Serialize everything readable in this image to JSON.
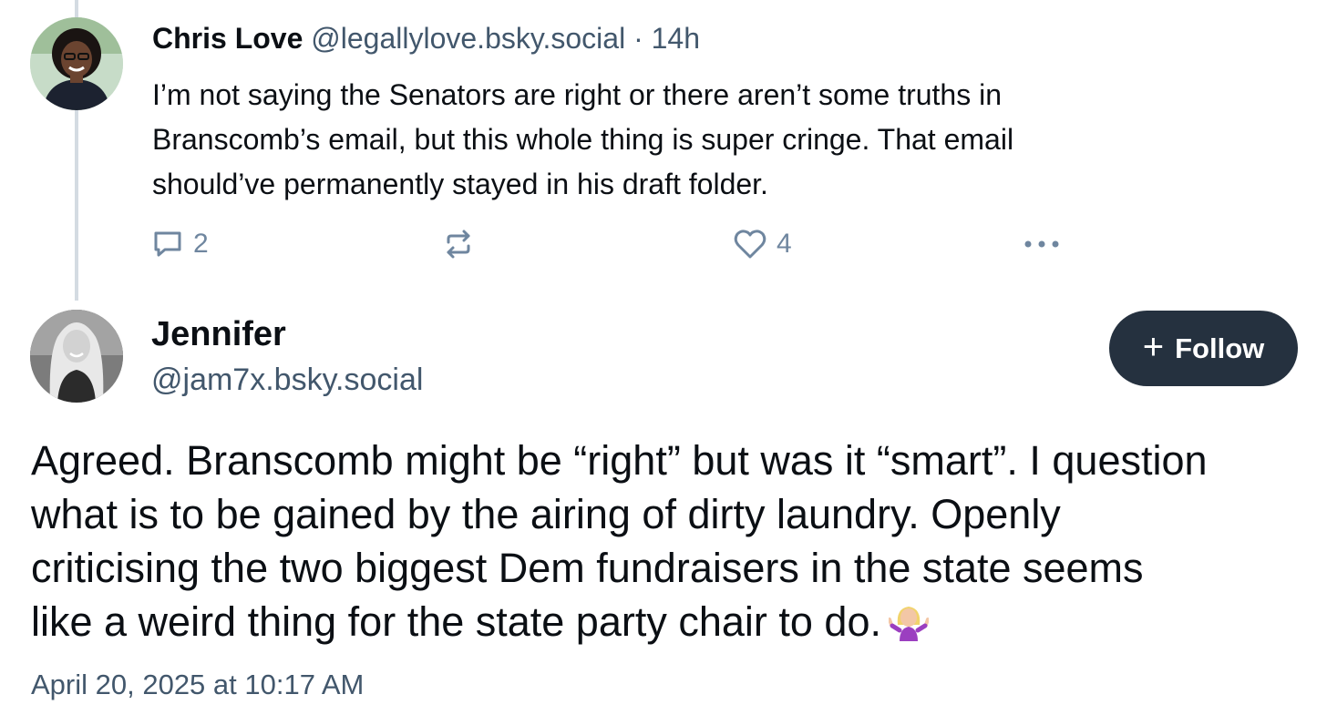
{
  "reply": {
    "author_name": "Chris Love",
    "handle": "@legallylove.bsky.social",
    "separator": "·",
    "time": "14h",
    "lines": [
      "I’m not saying the Senators are right or there aren’t some truths in",
      "Branscomb’s email, but this whole thing is super cringe. That email",
      "should’ve permanently stayed in his draft folder."
    ],
    "reply_count": "2",
    "like_count": "4"
  },
  "post": {
    "author_name": "Jennifer",
    "handle": "@jam7x.bsky.social",
    "follow_plus": "+",
    "follow_label": "Follow",
    "lines": [
      "Agreed. Branscomb might be “right” but was it “smart”. I question",
      "what is to be gained by the airing of dirty laundry. Openly",
      "criticising the two biggest Dem fundraisers in the state seems",
      "like a weird thing for the state party chair to do."
    ],
    "emoji": "woman-shrugging-emoji",
    "timestamp": "April 20, 2025 at 10:17 AM"
  },
  "icons": {
    "reply": "speech-bubble-icon",
    "repost": "repost-arrows-icon",
    "like": "heart-outline-icon",
    "more": "ellipsis-icon"
  },
  "colors": {
    "thread_line": "#d4dbe2",
    "secondary_text": "#42576c",
    "action_icons": "#6f869f",
    "follow_button_bg": "#25313f"
  }
}
